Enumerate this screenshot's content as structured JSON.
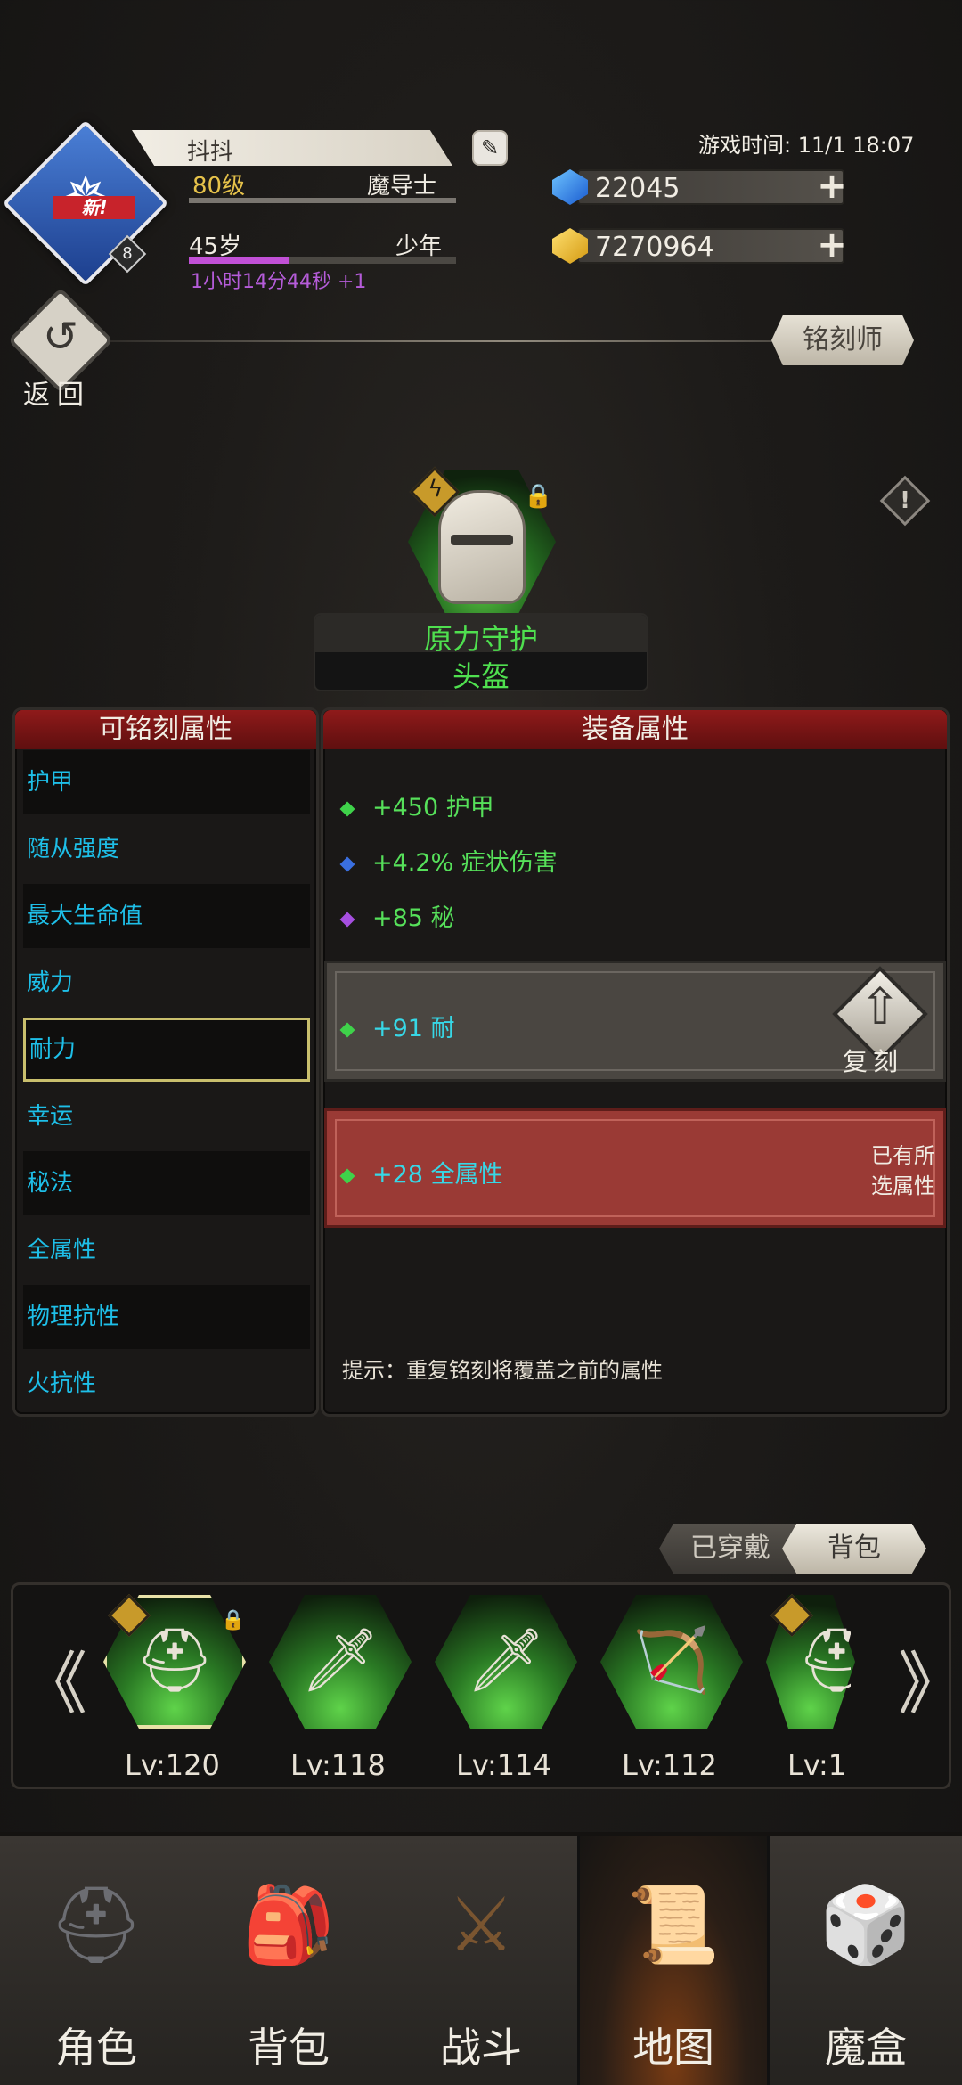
{
  "header": {
    "player_name": "抖抖",
    "level": "80级",
    "class": "魔导士",
    "age": "45岁",
    "age_stage": "少年",
    "age_timer": "1小时14分44秒 +1",
    "new_badge": "新!",
    "avatar_level": "8",
    "game_time": "游戏时间: 11/1 18:07",
    "gems": "22045",
    "gold": "7270964",
    "plus": "+"
  },
  "nav_top": {
    "back_label": "返回",
    "engraver_label": "铭刻师"
  },
  "item": {
    "name": "原力守护",
    "type": "头盔"
  },
  "left_panel": {
    "title": "可铭刻属性",
    "attributes": [
      "护甲",
      "随从强度",
      "最大生命值",
      "威力",
      "耐力",
      "幸运",
      "秘法",
      "全属性",
      "物理抗性",
      "火抗性"
    ],
    "selected_index": 4
  },
  "right_panel": {
    "title": "装备属性",
    "base_stats": [
      {
        "text": "+450 护甲",
        "color": "#3fd24a"
      },
      {
        "text": "+4.2% 症状伤害",
        "color": "#3a6fe0"
      },
      {
        "text": "+85 秘",
        "color": "#a64fe0"
      }
    ],
    "engrave_slot": {
      "text": "+91 耐",
      "action": "复刻"
    },
    "existing_slot": {
      "text": "+28 全属性",
      "note_line1": "已有所",
      "note_line2": "选属性"
    },
    "hint": "提示：重复铭刻将覆盖之前的属性"
  },
  "equipment_tabs": {
    "worn": "已穿戴",
    "bag": "背包"
  },
  "carousel": {
    "prev": "《",
    "next": "》",
    "items": [
      {
        "level": "Lv:120",
        "icon": "helmet-icon",
        "glyph": "⛑",
        "badge": true,
        "lock": true,
        "selected": true
      },
      {
        "level": "Lv:118",
        "icon": "sword-icon",
        "glyph": "🗡",
        "badge": false,
        "lock": false,
        "selected": false
      },
      {
        "level": "Lv:114",
        "icon": "sword-icon",
        "glyph": "🗡",
        "badge": false,
        "lock": false,
        "selected": false
      },
      {
        "level": "Lv:112",
        "icon": "crossbow-icon",
        "glyph": "🏹",
        "badge": false,
        "lock": false,
        "selected": false
      },
      {
        "level": "Lv:1",
        "icon": "helmet-icon",
        "glyph": "⛑",
        "badge": true,
        "lock": false,
        "selected": false
      }
    ]
  },
  "bottom_nav": [
    {
      "label": "角色",
      "icon": "viking-helmet-icon",
      "glyph": "⛑"
    },
    {
      "label": "背包",
      "icon": "backpack-icon",
      "glyph": "🎒"
    },
    {
      "label": "战斗",
      "icon": "sword-shield-icon",
      "glyph": "⚔"
    },
    {
      "label": "地图",
      "icon": "scroll-map-icon",
      "glyph": "📜"
    },
    {
      "label": "魔盒",
      "icon": "magic-box-icon",
      "glyph": "🎲"
    }
  ],
  "active_nav_index": 3
}
